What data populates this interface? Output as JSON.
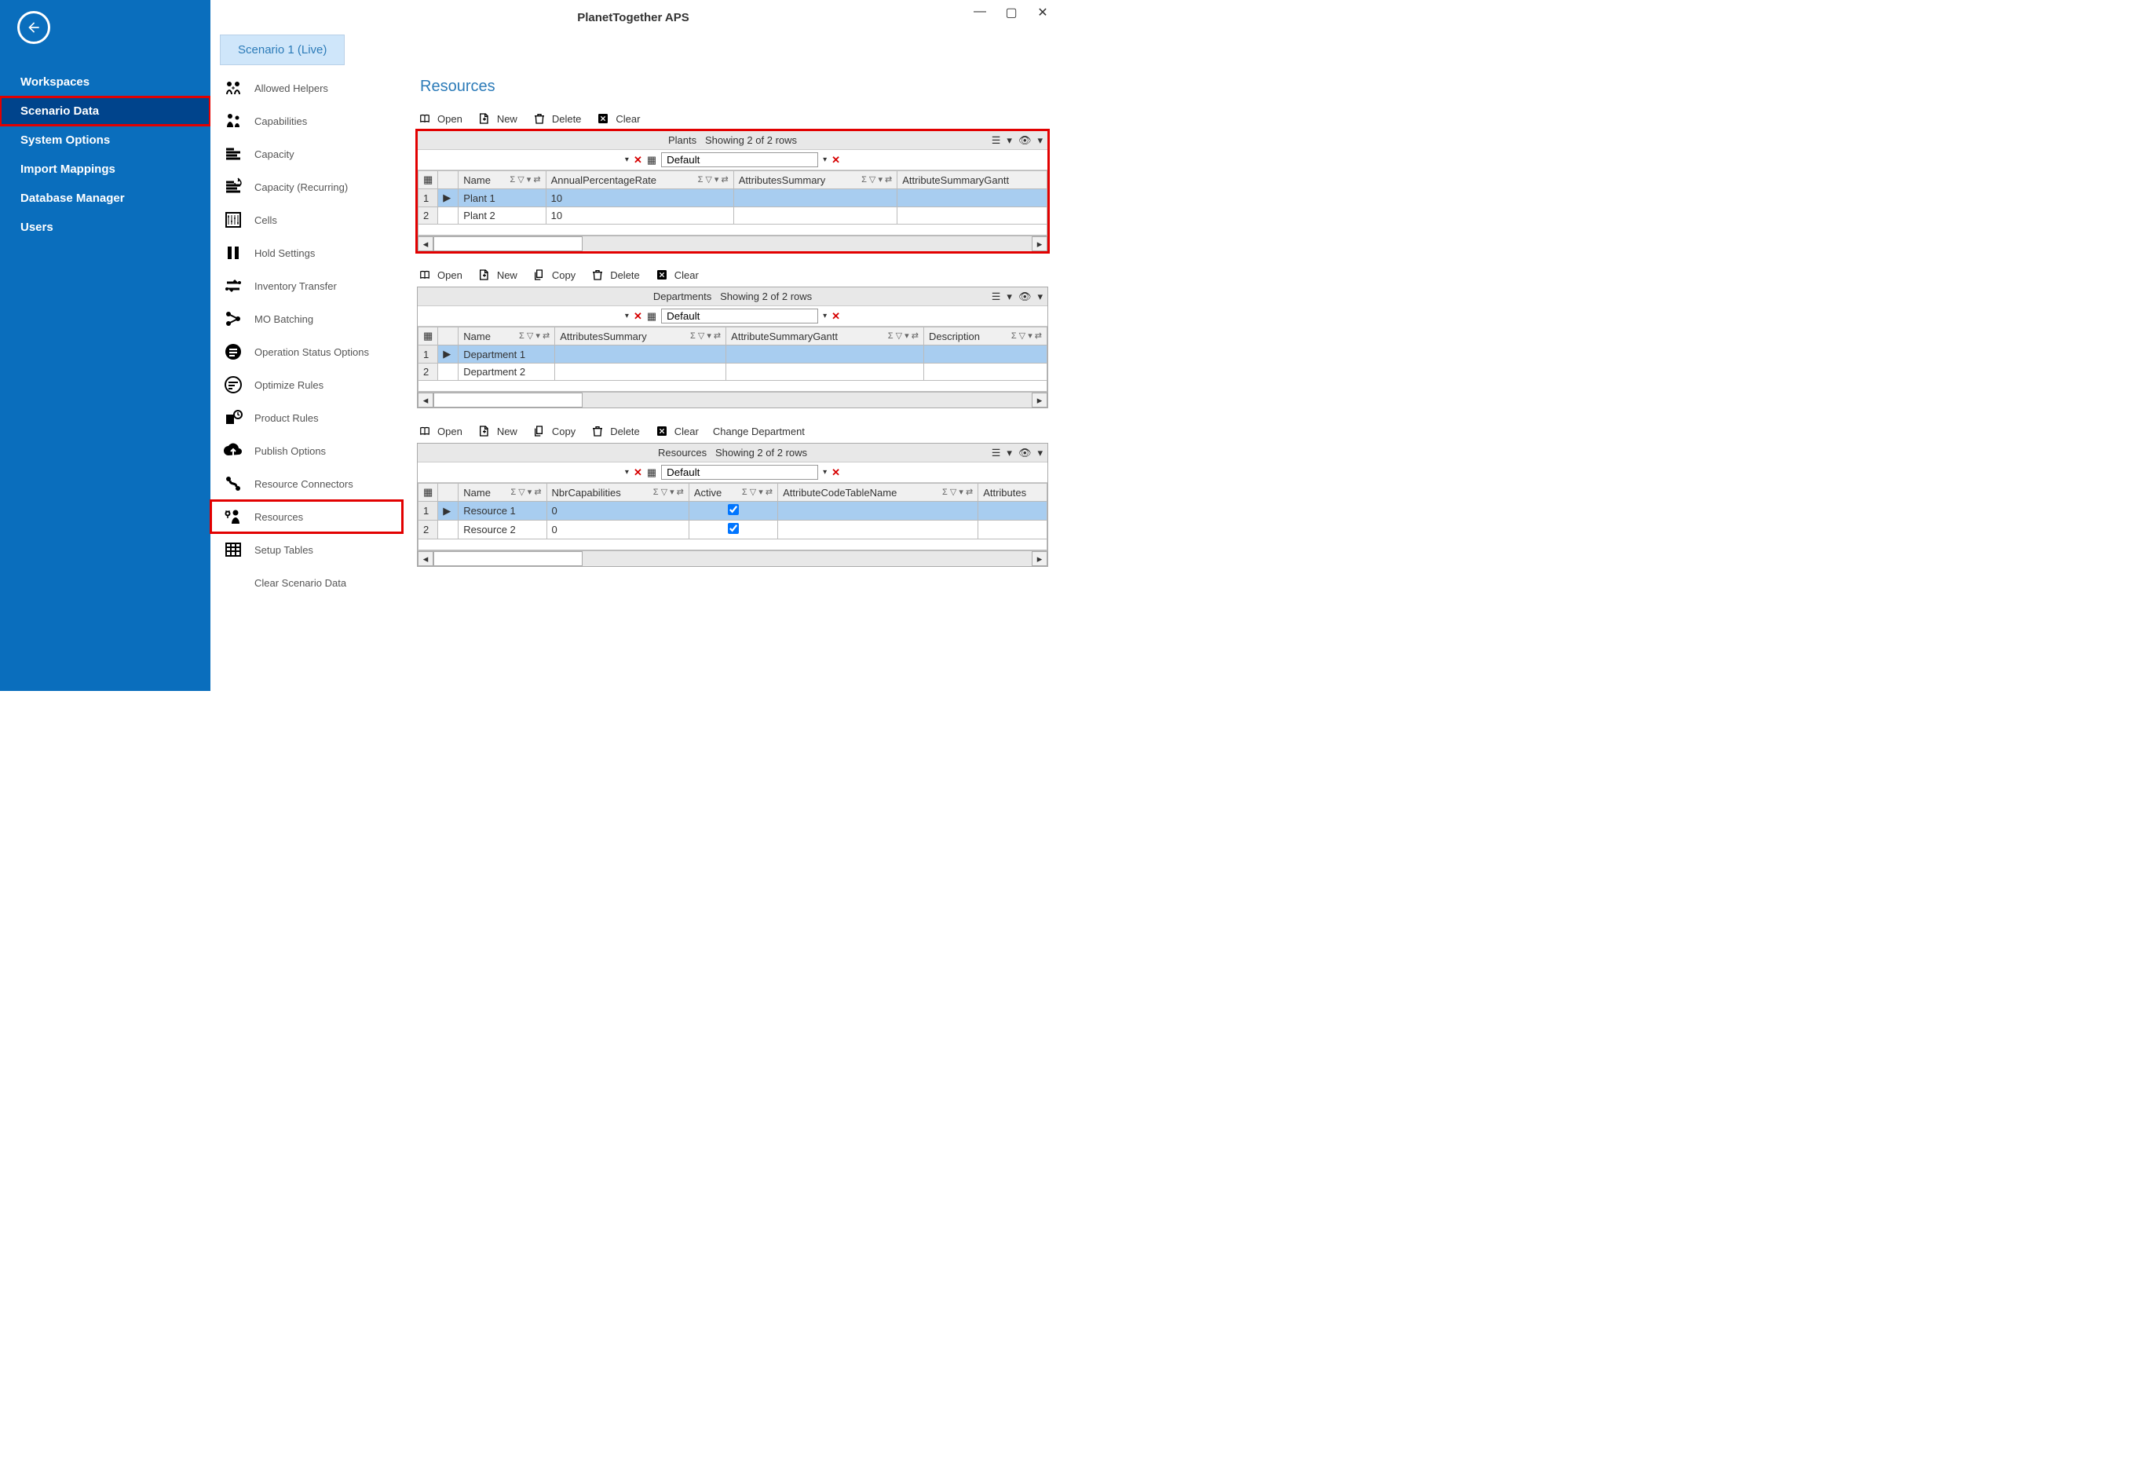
{
  "app_title": "PlanetTogether APS",
  "sidebar": {
    "items": [
      {
        "label": "Workspaces"
      },
      {
        "label": "Scenario Data",
        "selected": true,
        "highlighted": true
      },
      {
        "label": "System Options"
      },
      {
        "label": "Import Mappings"
      },
      {
        "label": "Database Manager"
      },
      {
        "label": "Users"
      }
    ]
  },
  "tabs": [
    {
      "label": "Scenario 1 (Live)"
    }
  ],
  "subnav": [
    {
      "label": "Allowed Helpers",
      "icon": "allowed-helpers-icon"
    },
    {
      "label": "Capabilities",
      "icon": "capabilities-icon"
    },
    {
      "label": "Capacity",
      "icon": "capacity-icon"
    },
    {
      "label": "Capacity (Recurring)",
      "icon": "capacity-recurring-icon"
    },
    {
      "label": "Cells",
      "icon": "cells-icon"
    },
    {
      "label": "Hold Settings",
      "icon": "hold-settings-icon"
    },
    {
      "label": "Inventory Transfer",
      "icon": "inventory-transfer-icon"
    },
    {
      "label": "MO Batching",
      "icon": "mo-batching-icon"
    },
    {
      "label": "Operation Status Options",
      "icon": "operation-status-icon"
    },
    {
      "label": "Optimize Rules",
      "icon": "optimize-rules-icon"
    },
    {
      "label": "Product Rules",
      "icon": "product-rules-icon"
    },
    {
      "label": "Publish Options",
      "icon": "publish-options-icon"
    },
    {
      "label": "Resource Connectors",
      "icon": "resource-connectors-icon"
    },
    {
      "label": "Resources",
      "icon": "resources-icon",
      "highlighted": true
    },
    {
      "label": "Setup Tables",
      "icon": "setup-tables-icon"
    },
    {
      "label": "Clear Scenario Data",
      "icon": "clear-scenario-icon",
      "clear": true
    }
  ],
  "page": {
    "title": "Resources"
  },
  "toolbars": {
    "open": "Open",
    "new": "New",
    "copy": "Copy",
    "delete": "Delete",
    "clear": "Clear",
    "change_dept": "Change Department"
  },
  "grids": {
    "plants": {
      "title": "Plants",
      "showing": "Showing 2 of 2 rows",
      "layout": "Default",
      "columns": [
        "Name",
        "AnnualPercentageRate",
        "AttributesSummary",
        "AttributeSummaryGantt"
      ],
      "rows": [
        {
          "num": "1",
          "Name": "Plant 1",
          "AnnualPercentageRate": "10",
          "AttributesSummary": "",
          "AttributeSummaryGantt": ""
        },
        {
          "num": "2",
          "Name": "Plant 2",
          "AnnualPercentageRate": "10",
          "AttributesSummary": "",
          "AttributeSummaryGantt": ""
        }
      ]
    },
    "departments": {
      "title": "Departments",
      "showing": "Showing 2 of 2 rows",
      "layout": "Default",
      "columns": [
        "Name",
        "AttributesSummary",
        "AttributeSummaryGantt",
        "Description"
      ],
      "rows": [
        {
          "num": "1",
          "Name": "Department 1",
          "AttributesSummary": "",
          "AttributeSummaryGantt": "",
          "Description": ""
        },
        {
          "num": "2",
          "Name": "Department 2",
          "AttributesSummary": "",
          "AttributeSummaryGantt": "",
          "Description": ""
        }
      ]
    },
    "resources": {
      "title": "Resources",
      "showing": "Showing 2 of 2 rows",
      "layout": "Default",
      "columns": [
        "Name",
        "NbrCapabilities",
        "Active",
        "AttributeCodeTableName",
        "Attributes"
      ],
      "rows": [
        {
          "num": "1",
          "Name": "Resource 1",
          "NbrCapabilities": "0",
          "Active": true,
          "AttributeCodeTableName": "",
          "Attributes": ""
        },
        {
          "num": "2",
          "Name": "Resource 2",
          "NbrCapabilities": "0",
          "Active": true,
          "AttributeCodeTableName": "",
          "Attributes": ""
        }
      ]
    }
  }
}
